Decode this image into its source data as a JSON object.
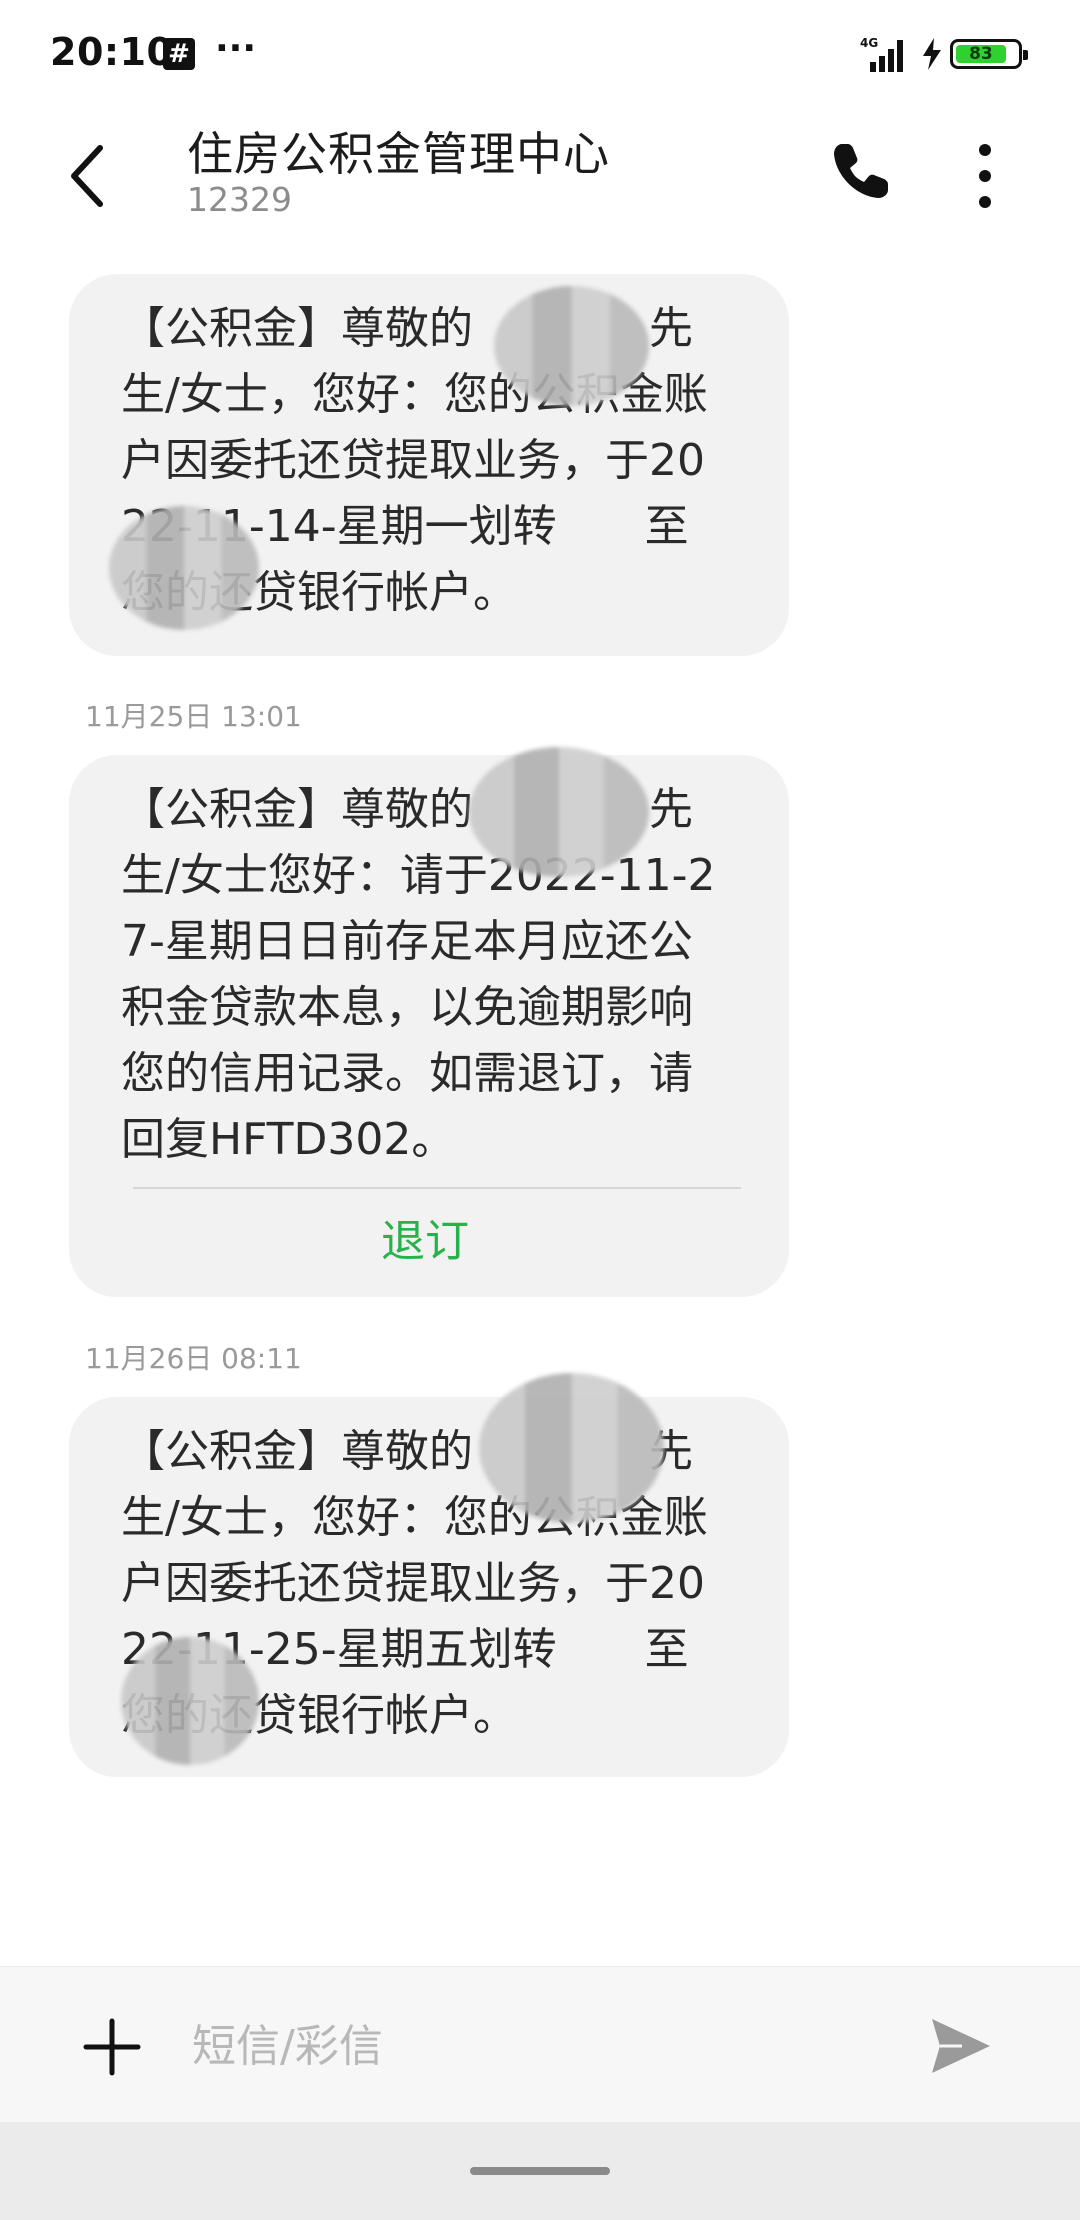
{
  "status_bar": {
    "time": "20:10",
    "notification_icon": "hash-icon",
    "more_icon": "ellipsis-icon",
    "network": "4G",
    "battery_level": "83",
    "battery_color": "#2ed12e"
  },
  "header": {
    "title": "住房公积金管理中心",
    "subtitle": "12329"
  },
  "messages": [
    {
      "text": "【公积金】尊敬的　　　　先生/女士，您好：您的公积金账户因委托还贷提取业务，于2022-11-14-星期一划转　　至您的还贷银行帐户。"
    },
    {
      "timestamp": "11月25日 13:01",
      "text": "【公积金】尊敬的　　　　先生/女士您好：请于2022-11-27-星期日日前存足本月应还公积金贷款本息，以免逾期影响您的信用记录。如需退订，请回复HFTD302。",
      "action_label": "退订",
      "action_color": "#27b24a"
    },
    {
      "timestamp": "11月26日 08:11",
      "text": "【公积金】尊敬的　　　　先生/女士，您好：您的公积金账户因委托还贷提取业务，于2022-11-25-星期五划转　　至您的还贷银行帐户。"
    }
  ],
  "composer": {
    "placeholder": "短信/彩信"
  }
}
